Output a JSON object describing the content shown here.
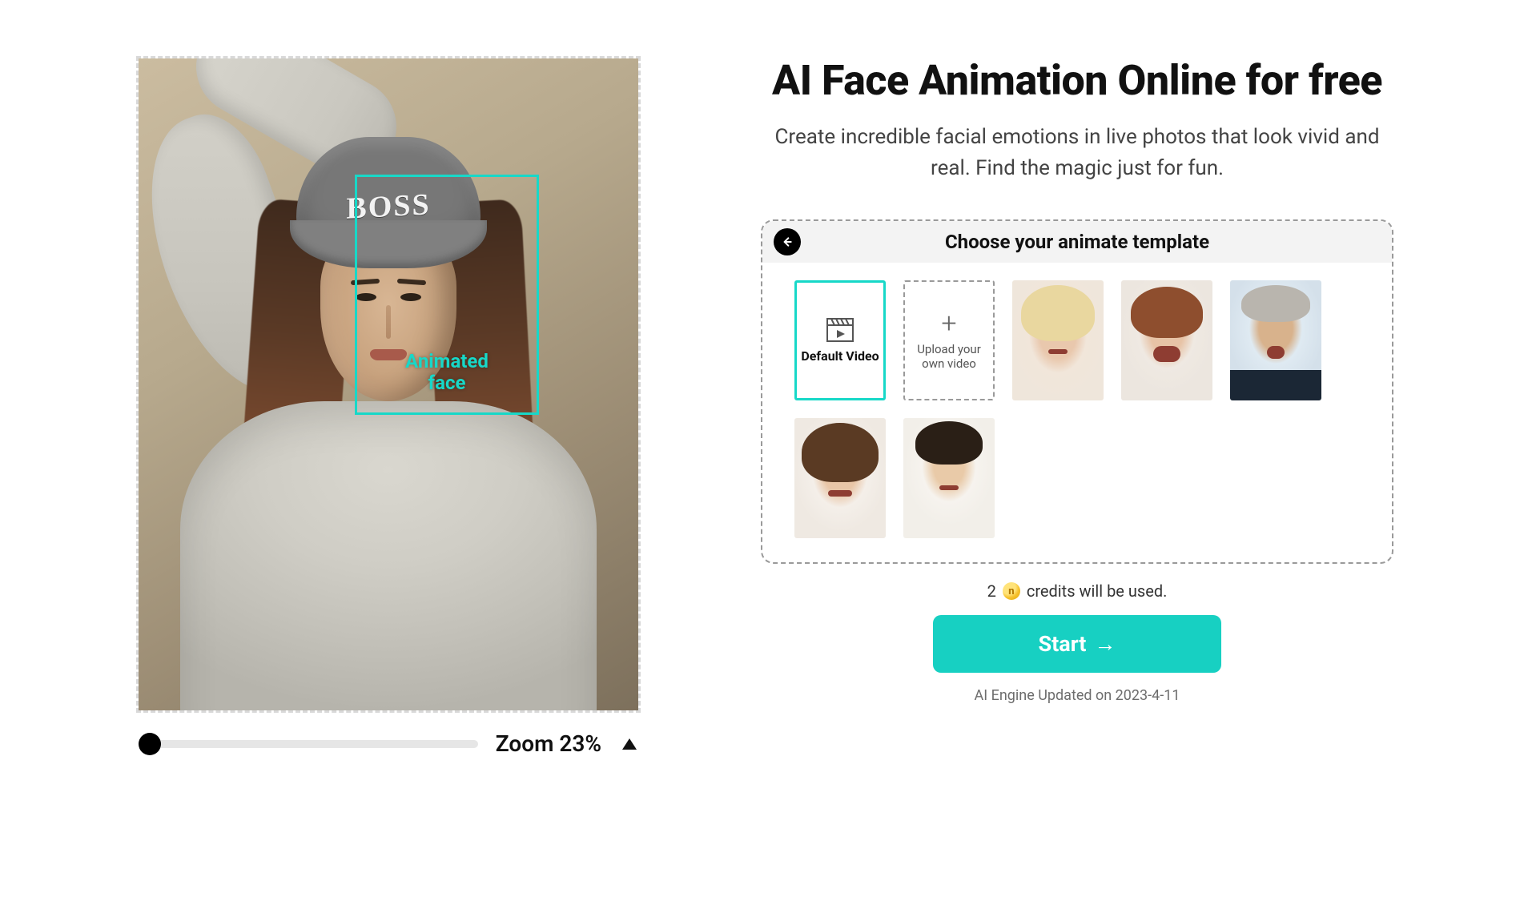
{
  "editor": {
    "face_box_label": "Animated\nface",
    "beanie_text": "BOSS",
    "zoom": {
      "label": "Zoom 23%",
      "percent": 23
    }
  },
  "headline": "AI Face Animation Online for free",
  "sub": "Create incredible facial emotions in live photos that look vivid and real. Find the magic just for fun.",
  "panel": {
    "title": "Choose your animate template",
    "default_label": "Default Video",
    "upload_label": "Upload your own video"
  },
  "credits": {
    "count": "2",
    "coin_glyph": "n",
    "suffix": "credits will be used."
  },
  "start_label": "Start",
  "updated": "AI Engine Updated on 2023-4-11",
  "colors": {
    "accent": "#17d0c2",
    "detect": "#17d8c8"
  }
}
